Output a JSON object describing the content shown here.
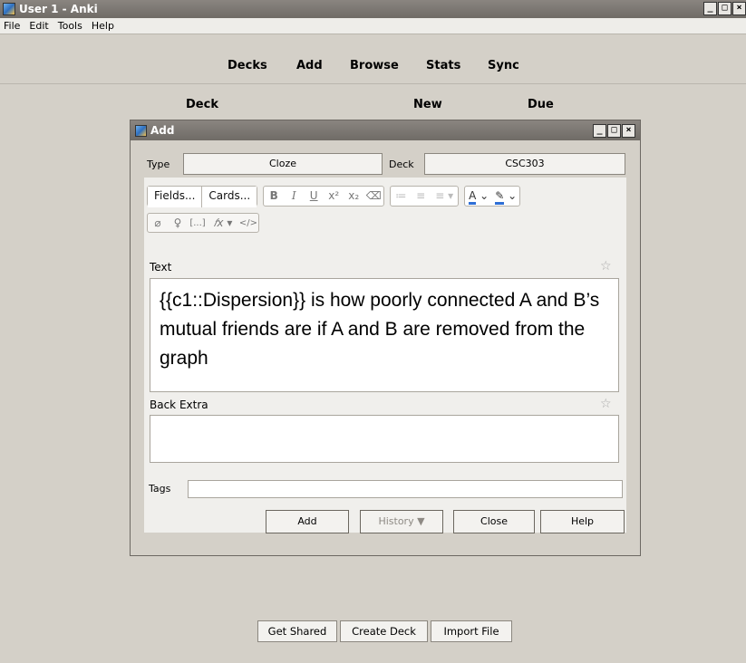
{
  "window": {
    "title": "User 1 - Anki",
    "controls": [
      "_",
      "□",
      "×"
    ]
  },
  "menu": [
    "File",
    "Edit",
    "Tools",
    "Help"
  ],
  "toolbar": {
    "decks": "Decks",
    "add": "Add",
    "browse": "Browse",
    "stats": "Stats",
    "sync": "Sync"
  },
  "deck_table": {
    "deck": "Deck",
    "new": "New",
    "due": "Due"
  },
  "bottom_buttons": {
    "get_shared": "Get Shared",
    "create_deck": "Create Deck",
    "import_file": "Import File"
  },
  "dialog": {
    "title": "Add",
    "type_label": "Type",
    "type_value": "Cloze",
    "deck_label": "Deck",
    "deck_value": "CSC303",
    "fields_button": "Fields...",
    "cards_button": "Cards...",
    "format_icons": {
      "bold": "B",
      "italic": "I",
      "underline": "U",
      "superscript": "x²",
      "subscript": "x₂",
      "eraser": "⌫",
      "bullet_list": "≔",
      "numbered_list": "≡",
      "align": "≡",
      "text_color": "A",
      "highlight": "✎"
    },
    "insert_icons": {
      "attach": "📎",
      "record": "🎙",
      "cloze": "[...]",
      "math": "𝑓x",
      "html": "</>"
    },
    "fields": [
      {
        "name": "Text",
        "value": "{{c1::Dispersion}} is how poorly connected A and B’s mutual friends are if A and B are removed from the graph"
      },
      {
        "name": "Back Extra",
        "value": ""
      }
    ],
    "tags_label": "Tags",
    "tags_value": "",
    "buttons": {
      "add": "Add",
      "history": "History ▼",
      "close": "Close",
      "help": "Help"
    }
  },
  "colors": {
    "titlebar": "#7b7772",
    "background": "#d4d0c8",
    "text_color_underline": "#2f6fd6"
  }
}
